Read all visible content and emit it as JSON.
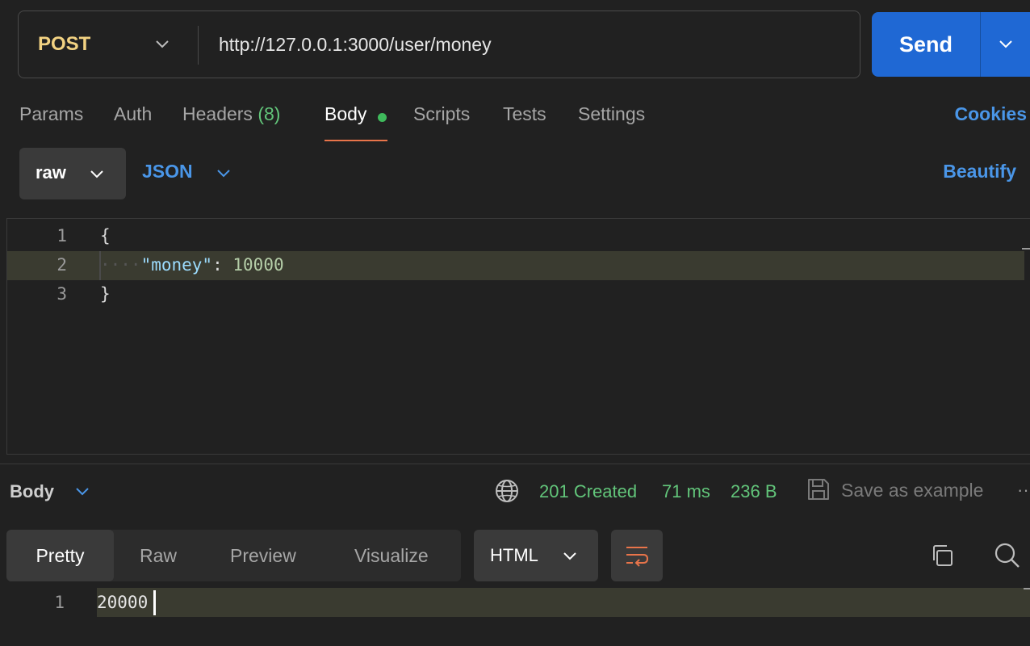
{
  "request": {
    "method": "POST",
    "url": "http://127.0.0.1:3000/user/money",
    "send_label": "Send"
  },
  "tabs": {
    "params": "Params",
    "auth": "Auth",
    "headers": "Headers",
    "headers_count": "(8)",
    "body": "Body",
    "scripts": "Scripts",
    "tests": "Tests",
    "settings": "Settings",
    "cookies": "Cookies"
  },
  "body_options": {
    "mode": "raw",
    "language": "JSON",
    "beautify": "Beautify"
  },
  "editor": {
    "lines": [
      {
        "num": "1",
        "text": "{"
      },
      {
        "num": "2",
        "indent": "····",
        "key": "\"money\"",
        "sep": ": ",
        "value": "10000"
      },
      {
        "num": "3",
        "text": "}"
      }
    ]
  },
  "response": {
    "section_label": "Body",
    "status": "201 Created",
    "time": "71 ms",
    "size": "236 B",
    "save_example": "Save as example",
    "more": "··",
    "views": [
      "Pretty",
      "Raw",
      "Preview",
      "Visualize"
    ],
    "format": "HTML",
    "lines": [
      {
        "num": "1",
        "text": "20000"
      }
    ]
  },
  "colors": {
    "method": "#f2d282",
    "send": "#1f68d4",
    "link": "#4a96e8",
    "status_ok": "#62c57a",
    "tab_underline": "#e8744a",
    "body_dot": "#3fba5c"
  },
  "icons": {
    "method_dropdown": "chevron-down-icon",
    "send_dropdown": "chevron-down-icon",
    "network": "globe-icon",
    "save": "save-icon",
    "wrap": "wrap-lines-icon",
    "copy": "copy-icon",
    "search": "search-icon"
  }
}
